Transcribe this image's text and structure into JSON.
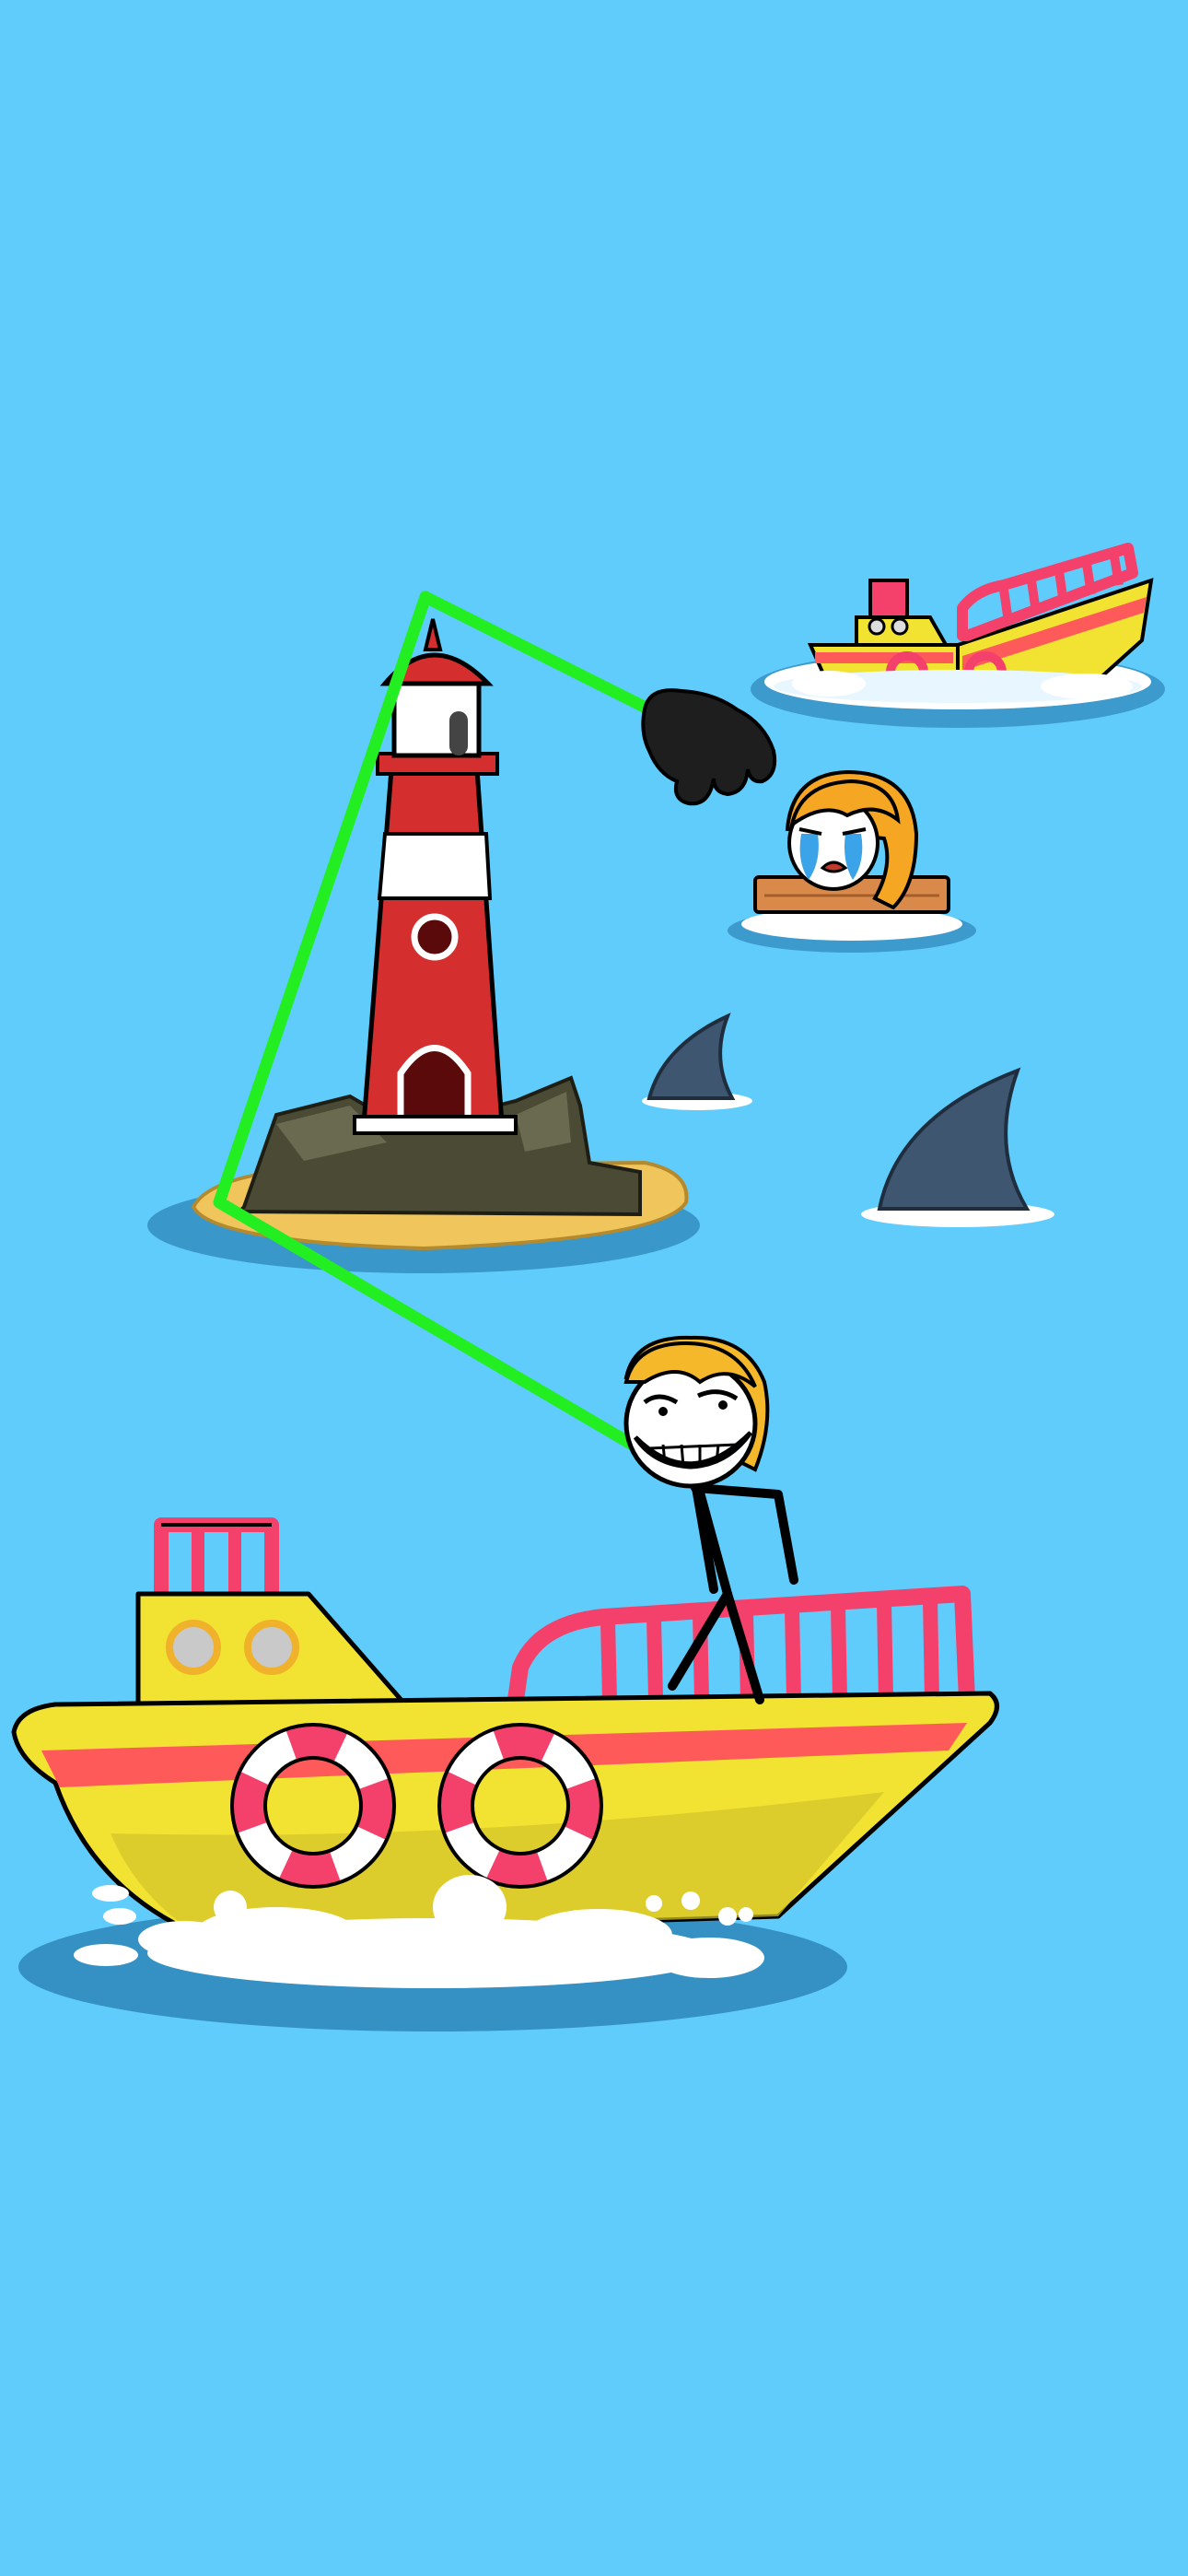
{
  "game": {
    "kind": "draw-the-arm puzzle",
    "sea_color": "#5FCCFB",
    "rope_color": "#22EE22",
    "player_glove_color": "#1E1E1E",
    "player_arm_stretch_level": 1.0,
    "characters": {
      "player": {
        "icon": "trollface-icon",
        "hair_color": "#F5B82A"
      },
      "victim": {
        "icon": "crying-woman-icon",
        "hair_color": "#F5A623"
      }
    },
    "hazards": [
      {
        "icon": "shark-fin-icon"
      },
      {
        "icon": "shark-fin-icon"
      }
    ],
    "props": [
      {
        "icon": "lighthouse-icon"
      },
      {
        "icon": "sinking-boat-icon"
      },
      {
        "icon": "player-boat-icon"
      },
      {
        "icon": "wooden-plank-icon"
      },
      {
        "icon": "life-ring-icon"
      }
    ],
    "palette": {
      "boat_yellow": "#F2E232",
      "boat_stripe": "#FF5A5A",
      "boat_rail": "#F4416C",
      "lighthouse_red": "#D42E2E",
      "sand": "#F0C65C",
      "rock": "#4A4A35",
      "shark": "#3E5670",
      "foam": "#FFFFFF",
      "water_shadow": "#2E86B8"
    }
  }
}
